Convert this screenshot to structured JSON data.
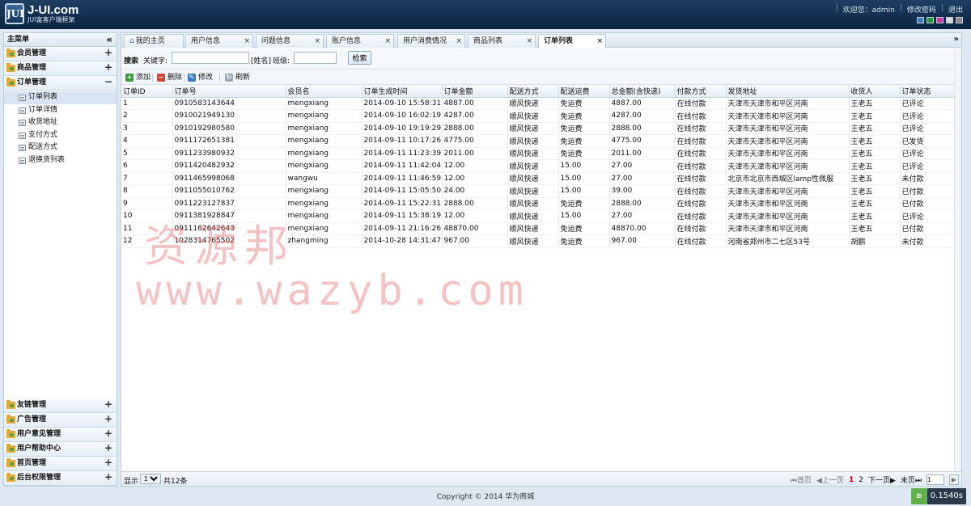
{
  "header": {
    "logo_mark": "JUI",
    "title": "J-UI.com",
    "subtitle": "JUI富客户端框架",
    "welcome": "欢迎您：admin",
    "change_password": "修改密码",
    "logout": "退出",
    "theme_colors": [
      "#3a78c0",
      "#1e9a3c",
      "#c83ca0",
      "#d8d8d8",
      "#8a8a8a"
    ]
  },
  "sidebar": {
    "title": "主菜单",
    "collapse_icon": "«",
    "groups_top": [
      {
        "label": "会员管理",
        "toggle": "+"
      },
      {
        "label": "商品管理",
        "toggle": "+"
      },
      {
        "label": "订单管理",
        "toggle": "−"
      }
    ],
    "sub_items": [
      "订单列表",
      "订单详情",
      "收货地址",
      "支付方式",
      "配送方式",
      "退换货列表"
    ],
    "active_sub": 0,
    "groups_bottom": [
      {
        "label": "友链管理",
        "toggle": "+"
      },
      {
        "label": "广告管理",
        "toggle": "+"
      },
      {
        "label": "用户意见管理",
        "toggle": "+"
      },
      {
        "label": "用户帮助中心",
        "toggle": "+"
      },
      {
        "label": "首页管理",
        "toggle": "+"
      },
      {
        "label": "后台权限管理",
        "toggle": "+"
      }
    ]
  },
  "tabs": [
    "我的主页",
    "用户信息",
    "问题信息",
    "账户信息",
    "用户消费情况",
    "商品列表",
    "订单列表"
  ],
  "tab_close": "×",
  "tab_more": "»",
  "search": {
    "title": "搜索",
    "keyword_label": "关键字:",
    "keyword_value": "",
    "name_label": "[姓名]",
    "class_label": "班级:",
    "class_value": "",
    "button": "检索"
  },
  "toolbar": {
    "add": "添加",
    "delete": "删除",
    "edit": "修改",
    "refresh": "刷新"
  },
  "table": {
    "headers": [
      "订单ID",
      "订单号",
      "会员名",
      "订单生成时间",
      "订单金额",
      "配送方式",
      "配送运费",
      "总金额(含快递)",
      "付款方式",
      "发货地址",
      "收货人",
      "订单状态"
    ],
    "rows": [
      [
        "1",
        "0910583143644",
        "mengxiang",
        "2014-09-10 15:58:31",
        "4887.00",
        "顺风快递",
        "免运费",
        "4887.00",
        "在线付款",
        "天津市天津市和平区河南",
        "王老五",
        "已评论"
      ],
      [
        "2",
        "0910021949130",
        "mengxiang",
        "2014-09-10 16:02:19",
        "4287.00",
        "顺风快递",
        "免运费",
        "4287.00",
        "在线付款",
        "天津市天津市和平区河南",
        "王老五",
        "已评论"
      ],
      [
        "3",
        "0910192980580",
        "mengxiang",
        "2014-09-10 19:19:29",
        "2888.00",
        "顺风快递",
        "免运费",
        "2888.00",
        "在线付款",
        "天津市天津市和平区河南",
        "王老五",
        "已评论"
      ],
      [
        "4",
        "0911172651381",
        "mengxiang",
        "2014-09-11 10:17:26",
        "4775.00",
        "顺风快递",
        "免运费",
        "4775.00",
        "在线付款",
        "天津市天津市和平区河南",
        "王老五",
        "已发货"
      ],
      [
        "5",
        "0911233980932",
        "mengxiang",
        "2014-09-11 11:23:39",
        "2011.00",
        "顺风快递",
        "免运费",
        "2011.00",
        "在线付款",
        "天津市天津市和平区河南",
        "王老五",
        "已评论"
      ],
      [
        "6",
        "0911420482932",
        "mengxiang",
        "2014-09-11 11:42:04",
        "12.00",
        "顺风快递",
        "15.00",
        "27.00",
        "在线付款",
        "天津市天津市和平区河南",
        "王老五",
        "已评论"
      ],
      [
        "7",
        "0911465998068",
        "wangwu",
        "2014-09-11 11:46:59",
        "12.00",
        "顺风快递",
        "15.00",
        "27.00",
        "在线付款",
        "北京市北京市西城区lamp性佩服",
        "王老五",
        "未付款"
      ],
      [
        "8",
        "0911055010762",
        "mengxiang",
        "2014-09-11 15:05:50",
        "24.00",
        "顺风快递",
        "15.00",
        "39.00",
        "在线付款",
        "天津市天津市和平区河南",
        "王老五",
        "已付款"
      ],
      [
        "9",
        "0911223127837",
        "mengxiang",
        "2014-09-11 15:22:31",
        "2888.00",
        "顺风快递",
        "免运费",
        "2888.00",
        "在线付款",
        "天津市天津市和平区河南",
        "王老五",
        "已付款"
      ],
      [
        "10",
        "0911381928847",
        "mengxiang",
        "2014-09-11 15:38:19",
        "12.00",
        "顺风快递",
        "15.00",
        "27.00",
        "在线付款",
        "天津市天津市和平区河南",
        "王老五",
        "已评论"
      ],
      [
        "11",
        "0911162642643",
        "mengxiang",
        "2014-09-11 21:16:26",
        "48870.00",
        "顺风快递",
        "免运费",
        "48870.00",
        "在线付款",
        "天津市天津市和平区河南",
        "王老五",
        "已付款"
      ],
      [
        "12",
        "1028314765502",
        "zhangming",
        "2014-10-28 14:31:47",
        "967.00",
        "顺风快递",
        "免运费",
        "967.00",
        "在线付款",
        "河南省郑州市二七区53号",
        "胡鹏",
        "未付款"
      ]
    ]
  },
  "pager": {
    "show_label": "显示",
    "page_size": "10",
    "total_label": "共12条",
    "first": "首页",
    "prev": "上一页",
    "current_page": "1",
    "page_2": "2",
    "next": "下一页",
    "last": "末页",
    "jump_value": "1"
  },
  "footer": {
    "copyright": "Copyright © 2014 华为商城",
    "timer": "0.1540s"
  },
  "watermark": {
    "line1": "资源邦",
    "line2": "www.wazyb.com"
  }
}
